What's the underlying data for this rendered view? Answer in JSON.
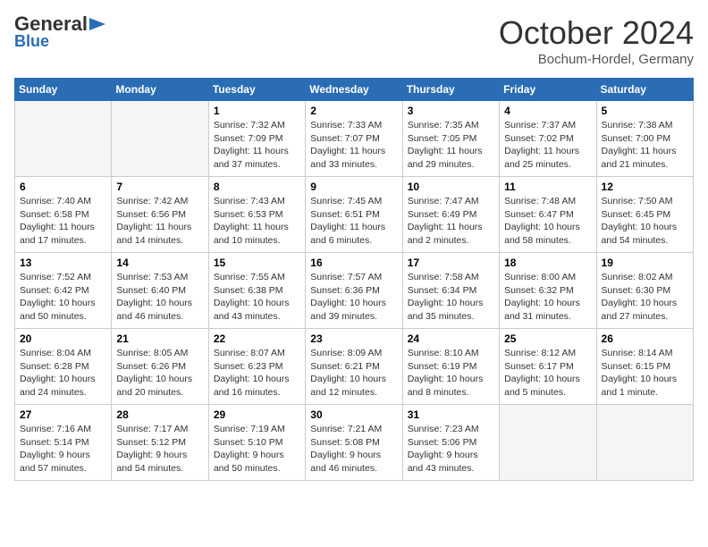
{
  "header": {
    "logo_general": "General",
    "logo_blue": "Blue",
    "month_title": "October 2024",
    "location": "Bochum-Hordel, Germany"
  },
  "weekdays": [
    "Sunday",
    "Monday",
    "Tuesday",
    "Wednesday",
    "Thursday",
    "Friday",
    "Saturday"
  ],
  "weeks": [
    [
      {
        "day": "",
        "info": ""
      },
      {
        "day": "",
        "info": ""
      },
      {
        "day": "1",
        "info": "Sunrise: 7:32 AM\nSunset: 7:09 PM\nDaylight: 11 hours and 37 minutes."
      },
      {
        "day": "2",
        "info": "Sunrise: 7:33 AM\nSunset: 7:07 PM\nDaylight: 11 hours and 33 minutes."
      },
      {
        "day": "3",
        "info": "Sunrise: 7:35 AM\nSunset: 7:05 PM\nDaylight: 11 hours and 29 minutes."
      },
      {
        "day": "4",
        "info": "Sunrise: 7:37 AM\nSunset: 7:02 PM\nDaylight: 11 hours and 25 minutes."
      },
      {
        "day": "5",
        "info": "Sunrise: 7:38 AM\nSunset: 7:00 PM\nDaylight: 11 hours and 21 minutes."
      }
    ],
    [
      {
        "day": "6",
        "info": "Sunrise: 7:40 AM\nSunset: 6:58 PM\nDaylight: 11 hours and 17 minutes."
      },
      {
        "day": "7",
        "info": "Sunrise: 7:42 AM\nSunset: 6:56 PM\nDaylight: 11 hours and 14 minutes."
      },
      {
        "day": "8",
        "info": "Sunrise: 7:43 AM\nSunset: 6:53 PM\nDaylight: 11 hours and 10 minutes."
      },
      {
        "day": "9",
        "info": "Sunrise: 7:45 AM\nSunset: 6:51 PM\nDaylight: 11 hours and 6 minutes."
      },
      {
        "day": "10",
        "info": "Sunrise: 7:47 AM\nSunset: 6:49 PM\nDaylight: 11 hours and 2 minutes."
      },
      {
        "day": "11",
        "info": "Sunrise: 7:48 AM\nSunset: 6:47 PM\nDaylight: 10 hours and 58 minutes."
      },
      {
        "day": "12",
        "info": "Sunrise: 7:50 AM\nSunset: 6:45 PM\nDaylight: 10 hours and 54 minutes."
      }
    ],
    [
      {
        "day": "13",
        "info": "Sunrise: 7:52 AM\nSunset: 6:42 PM\nDaylight: 10 hours and 50 minutes."
      },
      {
        "day": "14",
        "info": "Sunrise: 7:53 AM\nSunset: 6:40 PM\nDaylight: 10 hours and 46 minutes."
      },
      {
        "day": "15",
        "info": "Sunrise: 7:55 AM\nSunset: 6:38 PM\nDaylight: 10 hours and 43 minutes."
      },
      {
        "day": "16",
        "info": "Sunrise: 7:57 AM\nSunset: 6:36 PM\nDaylight: 10 hours and 39 minutes."
      },
      {
        "day": "17",
        "info": "Sunrise: 7:58 AM\nSunset: 6:34 PM\nDaylight: 10 hours and 35 minutes."
      },
      {
        "day": "18",
        "info": "Sunrise: 8:00 AM\nSunset: 6:32 PM\nDaylight: 10 hours and 31 minutes."
      },
      {
        "day": "19",
        "info": "Sunrise: 8:02 AM\nSunset: 6:30 PM\nDaylight: 10 hours and 27 minutes."
      }
    ],
    [
      {
        "day": "20",
        "info": "Sunrise: 8:04 AM\nSunset: 6:28 PM\nDaylight: 10 hours and 24 minutes."
      },
      {
        "day": "21",
        "info": "Sunrise: 8:05 AM\nSunset: 6:26 PM\nDaylight: 10 hours and 20 minutes."
      },
      {
        "day": "22",
        "info": "Sunrise: 8:07 AM\nSunset: 6:23 PM\nDaylight: 10 hours and 16 minutes."
      },
      {
        "day": "23",
        "info": "Sunrise: 8:09 AM\nSunset: 6:21 PM\nDaylight: 10 hours and 12 minutes."
      },
      {
        "day": "24",
        "info": "Sunrise: 8:10 AM\nSunset: 6:19 PM\nDaylight: 10 hours and 8 minutes."
      },
      {
        "day": "25",
        "info": "Sunrise: 8:12 AM\nSunset: 6:17 PM\nDaylight: 10 hours and 5 minutes."
      },
      {
        "day": "26",
        "info": "Sunrise: 8:14 AM\nSunset: 6:15 PM\nDaylight: 10 hours and 1 minute."
      }
    ],
    [
      {
        "day": "27",
        "info": "Sunrise: 7:16 AM\nSunset: 5:14 PM\nDaylight: 9 hours and 57 minutes."
      },
      {
        "day": "28",
        "info": "Sunrise: 7:17 AM\nSunset: 5:12 PM\nDaylight: 9 hours and 54 minutes."
      },
      {
        "day": "29",
        "info": "Sunrise: 7:19 AM\nSunset: 5:10 PM\nDaylight: 9 hours and 50 minutes."
      },
      {
        "day": "30",
        "info": "Sunrise: 7:21 AM\nSunset: 5:08 PM\nDaylight: 9 hours and 46 minutes."
      },
      {
        "day": "31",
        "info": "Sunrise: 7:23 AM\nSunset: 5:06 PM\nDaylight: 9 hours and 43 minutes."
      },
      {
        "day": "",
        "info": ""
      },
      {
        "day": "",
        "info": ""
      }
    ]
  ]
}
